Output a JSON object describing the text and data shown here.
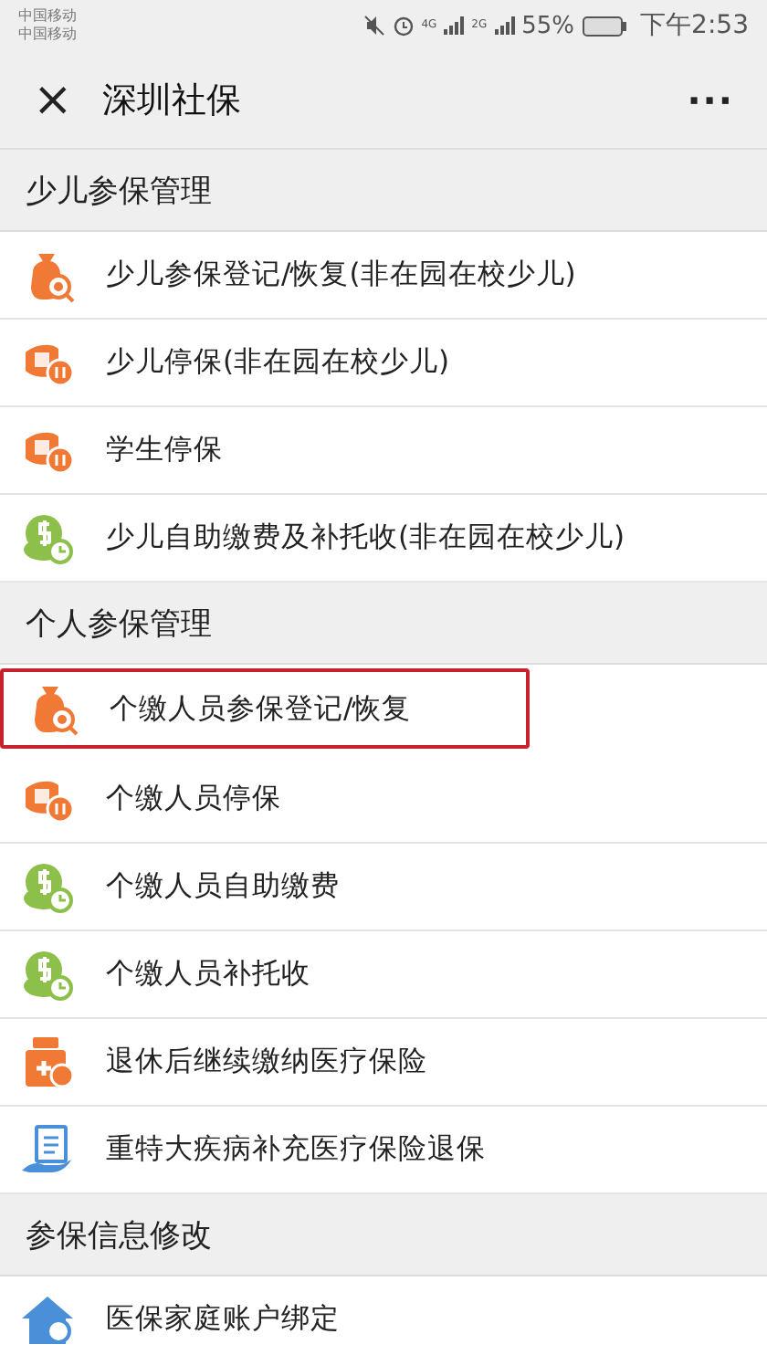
{
  "status_bar": {
    "carriers": [
      "中国移动",
      "中国移动"
    ],
    "network_1": "4G",
    "network_2": "2G",
    "battery": "55%",
    "time": "下午2:53"
  },
  "nav_bar": {
    "title": "深圳社保",
    "close": "×",
    "more": "···"
  },
  "sections": [
    {
      "title": "少儿参保管理",
      "items": [
        {
          "label": "少儿参保登记/恢复(非在园在校少儿)",
          "kind": "bag",
          "highlighted": false
        },
        {
          "label": "少儿停保(非在园在校少儿)",
          "kind": "stop",
          "highlighted": false
        },
        {
          "label": "学生停保",
          "kind": "stop",
          "highlighted": false
        },
        {
          "label": "少儿自助缴费及补托收(非在园在校少儿)",
          "kind": "coins",
          "highlighted": false
        }
      ]
    },
    {
      "title": "个人参保管理",
      "items": [
        {
          "label": "个缴人员参保登记/恢复",
          "kind": "bag",
          "highlighted": true
        },
        {
          "label": "个缴人员停保",
          "kind": "stop",
          "highlighted": false
        },
        {
          "label": "个缴人员自助缴费",
          "kind": "coins",
          "highlighted": false
        },
        {
          "label": "个缴人员补托收",
          "kind": "coins",
          "highlighted": false
        },
        {
          "label": "退休后继续缴纳医疗保险",
          "kind": "medkit",
          "highlighted": false
        },
        {
          "label": "重特大疾病补充医疗保险退保",
          "kind": "hand",
          "highlighted": false
        }
      ]
    },
    {
      "title": "参保信息修改",
      "items": [
        {
          "label": "医保家庭账户绑定",
          "kind": "house",
          "highlighted": false
        }
      ]
    }
  ]
}
